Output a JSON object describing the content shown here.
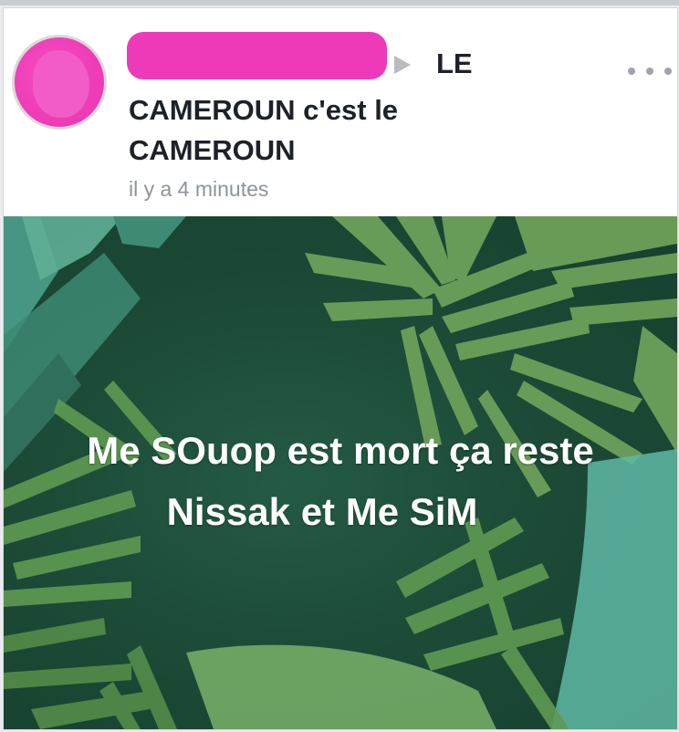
{
  "post": {
    "author": "",
    "target_group": {
      "line1": "LE",
      "line2": "CAMEROUN c'est le",
      "line3": "CAMEROUN"
    },
    "timestamp": "il y a 4 minutes",
    "more_options_icon": "ellipsis-icon",
    "arrow_icon": "triangle-right-icon",
    "image": {
      "caption_line1": "Me SOuop est mort ça reste",
      "caption_line2": "Nissak et Me SiM",
      "colors": {
        "background": "#1c4b37",
        "leaf_light": "#6ea05a",
        "leaf_teal": "#4d9e8c",
        "text": "#ffffff"
      }
    }
  },
  "colors": {
    "redaction": "#ee3ab8",
    "title_text": "#1d2129",
    "timestamp_text": "#8d949e"
  }
}
